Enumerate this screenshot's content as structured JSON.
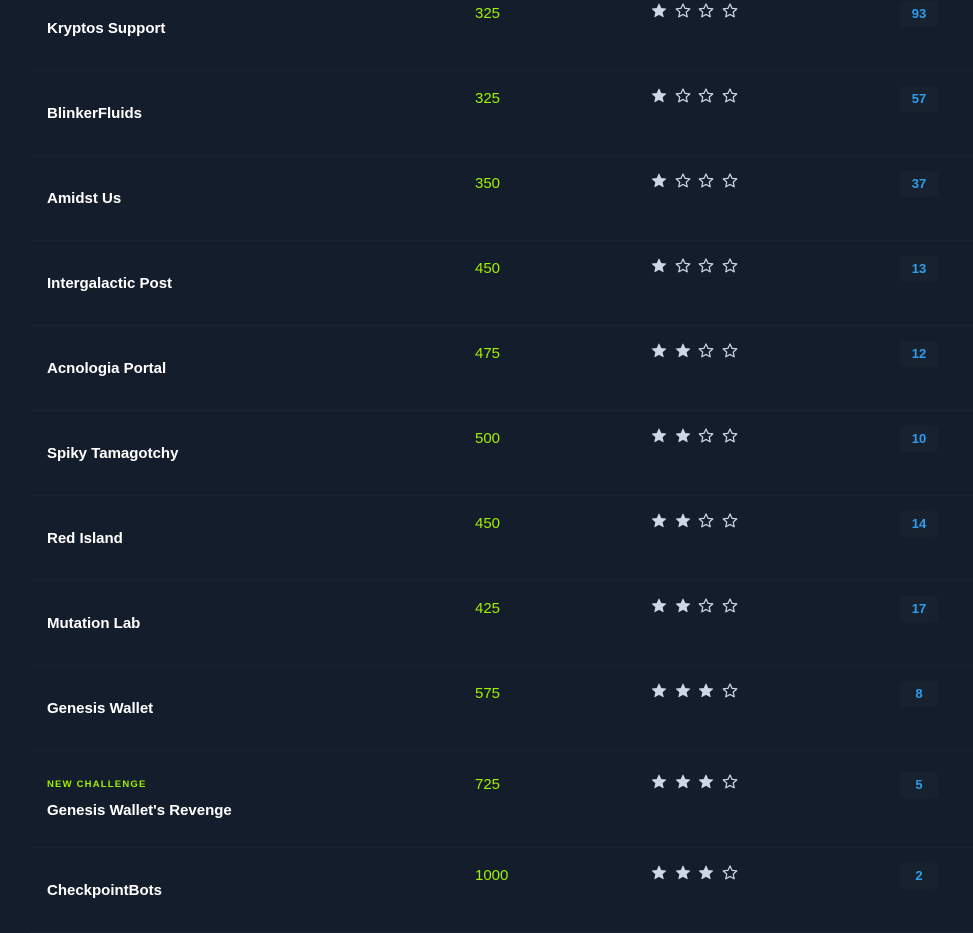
{
  "challenges": [
    {
      "tag": "",
      "name": "Kryptos Support",
      "points": "325",
      "difficulty": 1,
      "solves": "93"
    },
    {
      "tag": "",
      "name": "BlinkerFluids",
      "points": "325",
      "difficulty": 1,
      "solves": "57"
    },
    {
      "tag": "",
      "name": "Amidst Us",
      "points": "350",
      "difficulty": 1,
      "solves": "37"
    },
    {
      "tag": "",
      "name": "Intergalactic Post",
      "points": "450",
      "difficulty": 1,
      "solves": "13"
    },
    {
      "tag": "",
      "name": "Acnologia Portal",
      "points": "475",
      "difficulty": 2,
      "solves": "12"
    },
    {
      "tag": "",
      "name": "Spiky Tamagotchy",
      "points": "500",
      "difficulty": 2,
      "solves": "10"
    },
    {
      "tag": "",
      "name": "Red Island",
      "points": "450",
      "difficulty": 2,
      "solves": "14"
    },
    {
      "tag": "",
      "name": "Mutation Lab",
      "points": "425",
      "difficulty": 2,
      "solves": "17"
    },
    {
      "tag": "",
      "name": "Genesis Wallet",
      "points": "575",
      "difficulty": 3,
      "solves": "8"
    },
    {
      "tag": "NEW CHALLENGE",
      "name": "Genesis Wallet's Revenge",
      "points": "725",
      "difficulty": 3,
      "solves": "5"
    },
    {
      "tag": "",
      "name": "CheckpointBots",
      "points": "1000",
      "difficulty": 3,
      "solves": "2"
    }
  ],
  "max_stars": 4,
  "icons": {
    "filled": "star-filled-icon",
    "empty": "star-outline-icon"
  },
  "colors": {
    "background": "#141d2b",
    "name": "#ffffff",
    "points": "#9fef00",
    "tag": "#9fef00",
    "star": "#cfd6e4",
    "solves": "#2f9ceb"
  }
}
